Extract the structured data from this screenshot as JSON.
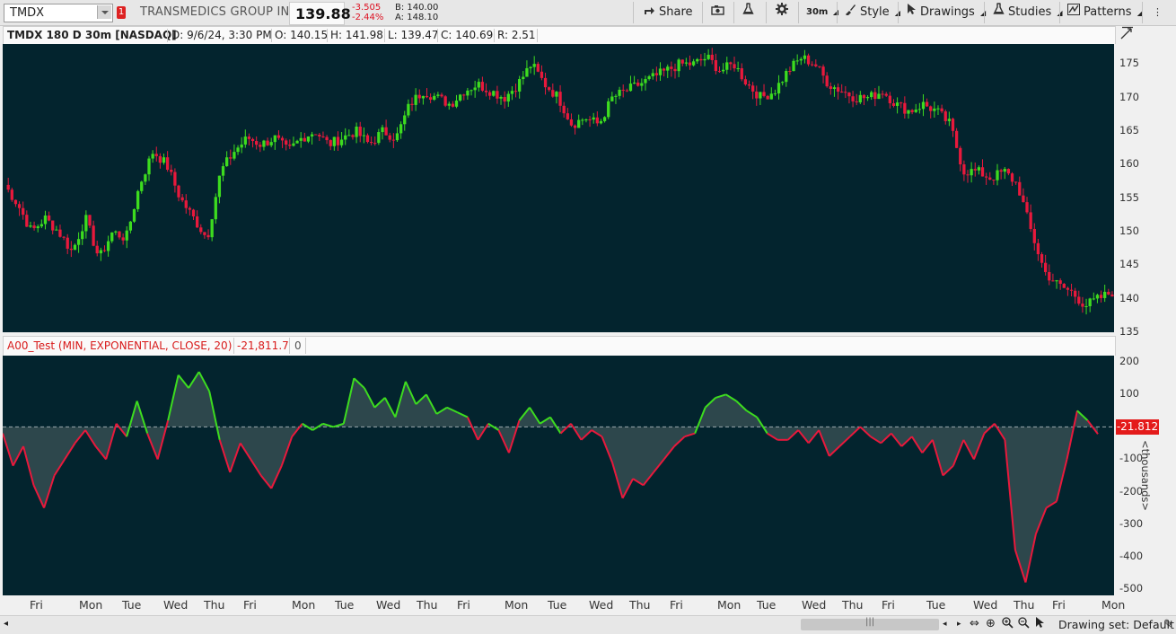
{
  "toolbar": {
    "symbol": "TMDX",
    "alert_count": "1",
    "company": "TRANSMEDICS GROUP IN",
    "last": "139.88",
    "change": "-3.505",
    "change_pct": "-2.44%",
    "bid": "B: 140.00",
    "ask": "A: 148.10",
    "share_label": "Share",
    "timeframe_label": "30m",
    "style_label": "Style",
    "drawings_label": "Drawings",
    "studies_label": "Studies",
    "patterns_label": "Patterns"
  },
  "chart_header": {
    "title": "TMDX 180 D 30m [NASDAQ]",
    "date": "D: 9/6/24, 3:30 PM",
    "open": "O: 140.15",
    "high": "H: 141.98",
    "low": "L: 139.47",
    "close": "C: 140.69",
    "range": "R: 2.51"
  },
  "indicator_header": {
    "name": "A00_Test (MIN, EXPONENTIAL, CLOSE, 20)",
    "value": "-21,811.7",
    "extra": "0"
  },
  "indicator_axis": {
    "current_value_label": "-21.812",
    "unit_label": "<thousands>"
  },
  "bottom_bar": {
    "drawing_set": "Drawing set: Default"
  },
  "chart_data": [
    {
      "type": "candlestick",
      "title": "TMDX 180 D 30m [NASDAQ]",
      "ylim": [
        135,
        178
      ],
      "yticks": [
        135,
        140,
        145,
        150,
        155,
        160,
        165,
        170,
        175
      ],
      "x_labels": [
        "Fri",
        "Mon",
        "Tue",
        "Wed",
        "Thu",
        "Fri",
        "Mon",
        "Tue",
        "Wed",
        "Thu",
        "Fri",
        "Mon",
        "Tue",
        "Wed",
        "Thu",
        "Fri",
        "Mon",
        "Tue",
        "Wed",
        "Thu",
        "Fri",
        "Tue",
        "Wed",
        "Thu",
        "Fri",
        "Mon"
      ],
      "close_path": [
        157,
        154,
        150,
        152,
        150,
        147,
        152,
        146,
        150,
        149,
        157,
        162,
        160,
        155,
        152,
        149,
        159,
        162,
        164,
        163,
        164,
        162,
        164,
        165,
        163,
        164,
        165,
        163,
        165,
        164,
        169,
        171,
        170,
        169,
        171,
        172,
        171,
        170,
        172,
        175,
        172,
        170,
        166,
        167,
        166,
        170,
        171,
        172,
        173,
        174,
        175,
        175,
        176,
        174,
        175,
        172,
        170,
        171,
        174,
        176,
        175,
        172,
        171,
        170,
        170,
        171,
        169,
        168,
        169,
        168,
        166,
        159,
        159,
        158,
        159,
        157,
        150,
        144,
        142,
        141,
        139,
        140,
        141
      ],
      "colors": {
        "up": "#3ddc1f",
        "down": "#e8193c"
      }
    },
    {
      "type": "area",
      "title": "A00_Test (MIN, EXPONENTIAL, CLOSE, 20)",
      "ylabel": "<thousands>",
      "ylim": [
        -500,
        200
      ],
      "yticks": [
        200,
        100,
        0,
        -100,
        -200,
        -300,
        -400,
        -500
      ],
      "values": [
        -20,
        -120,
        -60,
        -180,
        -250,
        -150,
        -100,
        -50,
        -10,
        -60,
        -100,
        10,
        -30,
        80,
        -20,
        -100,
        20,
        160,
        120,
        170,
        110,
        -40,
        -140,
        -50,
        -100,
        -150,
        -190,
        -120,
        -30,
        10,
        -10,
        10,
        0,
        10,
        150,
        120,
        60,
        90,
        30,
        140,
        70,
        100,
        40,
        60,
        45,
        30,
        -40,
        10,
        -10,
        -80,
        20,
        60,
        10,
        30,
        -20,
        10,
        -40,
        -10,
        -30,
        -110,
        -220,
        -160,
        -180,
        -140,
        -100,
        -60,
        -30,
        -20,
        60,
        90,
        100,
        80,
        50,
        30,
        -20,
        -40,
        -40,
        -10,
        -50,
        -10,
        -90,
        -60,
        -30,
        0,
        -30,
        -50,
        -20,
        -60,
        -30,
        -80,
        -40,
        -150,
        -120,
        -40,
        -100,
        -20,
        10,
        -40,
        -380,
        -480,
        -330,
        -250,
        -230,
        -100,
        50,
        20,
        -22
      ],
      "colors": {
        "positive": "#3ddc1f",
        "negative": "#e8193c"
      }
    }
  ]
}
